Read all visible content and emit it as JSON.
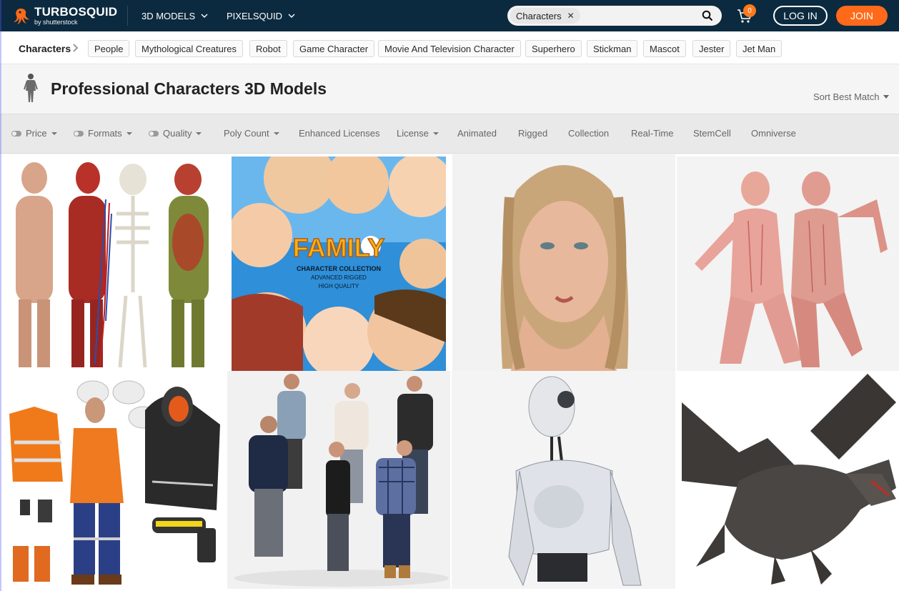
{
  "header": {
    "logo_main": "TURBOSQUID",
    "logo_sub": "by shutterstock",
    "nav": [
      {
        "label": "3D MODELS"
      },
      {
        "label": "PIXELSQUID"
      }
    ],
    "search_chip": "Characters",
    "cart_count": "0",
    "login_label": "LOG IN",
    "join_label": "JOIN",
    "colors": {
      "bg": "#0b2a3f",
      "accent": "#ff6a1a"
    }
  },
  "breadcrumb": {
    "root": "Characters",
    "tags": [
      "People",
      "Mythological Creatures",
      "Robot",
      "Game Character",
      "Movie And Television Character",
      "Superhero",
      "Stickman",
      "Mascot",
      "Jester",
      "Jet Man"
    ]
  },
  "page": {
    "title": "Professional Characters 3D Models",
    "sort_label": "Sort Best Match"
  },
  "filters": [
    {
      "label": "Price"
    },
    {
      "label": "Formats"
    },
    {
      "label": "Quality"
    },
    {
      "label": "Poly Count"
    },
    {
      "label": "Enhanced Licenses"
    },
    {
      "label": "License"
    },
    {
      "label": "Animated"
    },
    {
      "label": "Rigged"
    },
    {
      "label": "Collection"
    },
    {
      "label": "Real-Time"
    },
    {
      "label": "StemCell"
    },
    {
      "label": "Omniverse"
    }
  ],
  "products": [
    {
      "thumbnail_text": []
    },
    {
      "thumbnail_text": [
        "FAMILY",
        "CHARACTER COLLECTION",
        "ADVANCED RIGGED",
        "HIGH QUALITY"
      ]
    },
    {
      "thumbnail_text": []
    },
    {
      "thumbnail_text": []
    },
    {
      "thumbnail_text": []
    },
    {
      "thumbnail_text": []
    },
    {
      "thumbnail_text": []
    },
    {
      "thumbnail_text": []
    }
  ]
}
